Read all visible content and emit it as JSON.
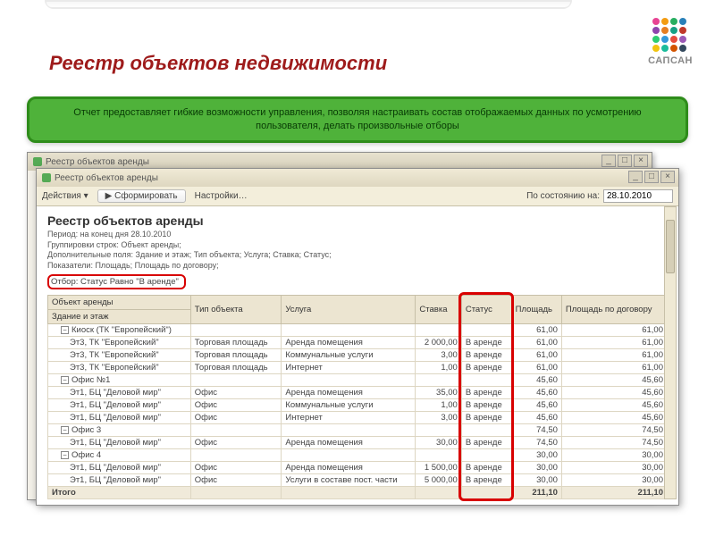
{
  "brand": {
    "name": "САПСАН"
  },
  "slide_title": "Реестр объектов недвижимости",
  "banner_text": "Отчет предоставляет гибкие возможности управления, позволяя настраивать состав отображаемых данных по усмотрению пользователя, делать произвольные отборы",
  "bg_window_title": "Реестр объектов аренды",
  "fg_window": {
    "title": "Реестр объектов аренды",
    "toolbar": {
      "actions_label": "Действия ▾",
      "form_button": "Сформировать",
      "settings_label": "Настройки…",
      "date_label": "По состоянию на:",
      "date_value": "28.10.2010"
    },
    "report": {
      "heading": "Реестр объектов аренды",
      "period": "Период: на конец дня 28.10.2010",
      "grouping": "Группировки строк: Объект аренды;",
      "extra_fields": "Дополнительные поля: Здание и этаж; Тип объекта; Услуга; Ставка; Статус;",
      "indicators": "Показатели: Площадь; Площадь по договору;",
      "filter_label": "Отбор:",
      "filter_value": "Статус Равно \"В аренде\""
    },
    "columns": {
      "c0": "Объект аренды",
      "c0b": "Здание и этаж",
      "c1": "Тип объекта",
      "c2": "Услуга",
      "c3": "Ставка",
      "c4": "Статус",
      "c5": "Площадь",
      "c6": "Площадь по договору"
    },
    "rows": [
      {
        "level": 1,
        "handle": "−",
        "c0": "Киоск (ТК \"Европейский\")",
        "c5": "61,00",
        "c6": "61,00"
      },
      {
        "level": 2,
        "c0": "Эт3, ТК \"Европейский\"",
        "c1": "Торговая площадь",
        "c2": "Аренда помещения",
        "c3": "2 000,00",
        "c4": "В аренде",
        "c5": "61,00",
        "c6": "61,00"
      },
      {
        "level": 2,
        "c0": "Эт3, ТК \"Европейский\"",
        "c1": "Торговая площадь",
        "c2": "Коммунальные услуги",
        "c3": "3,00",
        "c4": "В аренде",
        "c5": "61,00",
        "c6": "61,00"
      },
      {
        "level": 2,
        "c0": "Эт3, ТК \"Европейский\"",
        "c1": "Торговая площадь",
        "c2": "Интернет",
        "c3": "1,00",
        "c4": "В аренде",
        "c5": "61,00",
        "c6": "61,00"
      },
      {
        "level": 1,
        "handle": "−",
        "c0": "Офис №1",
        "c5": "45,60",
        "c6": "45,60"
      },
      {
        "level": 2,
        "c0": "Эт1, БЦ \"Деловой мир\"",
        "c1": "Офис",
        "c2": "Аренда помещения",
        "c3": "35,00",
        "c4": "В аренде",
        "c5": "45,60",
        "c6": "45,60"
      },
      {
        "level": 2,
        "c0": "Эт1, БЦ \"Деловой мир\"",
        "c1": "Офис",
        "c2": "Коммунальные услуги",
        "c3": "1,00",
        "c4": "В аренде",
        "c5": "45,60",
        "c6": "45,60"
      },
      {
        "level": 2,
        "c0": "Эт1, БЦ \"Деловой мир\"",
        "c1": "Офис",
        "c2": "Интернет",
        "c3": "3,00",
        "c4": "В аренде",
        "c5": "45,60",
        "c6": "45,60"
      },
      {
        "level": 1,
        "handle": "−",
        "c0": "Офис 3",
        "c5": "74,50",
        "c6": "74,50"
      },
      {
        "level": 2,
        "c0": "Эт1, БЦ \"Деловой мир\"",
        "c1": "Офис",
        "c2": "Аренда помещения",
        "c3": "30,00",
        "c4": "В аренде",
        "c5": "74,50",
        "c6": "74,50"
      },
      {
        "level": 1,
        "handle": "−",
        "c0": "Офис 4",
        "c5": "30,00",
        "c6": "30,00"
      },
      {
        "level": 2,
        "c0": "Эт1, БЦ \"Деловой мир\"",
        "c1": "Офис",
        "c2": "Аренда помещения",
        "c3": "1 500,00",
        "c4": "В аренде",
        "c5": "30,00",
        "c6": "30,00"
      },
      {
        "level": 2,
        "c0": "Эт1, БЦ \"Деловой мир\"",
        "c1": "Офис",
        "c2": "Услуги в составе пост. части",
        "c3": "5 000,00",
        "c4": "В аренде",
        "c5": "30,00",
        "c6": "30,00"
      },
      {
        "level": 0,
        "c0": "Итого",
        "c5": "211,10",
        "c6": "211,10"
      }
    ]
  },
  "logo_colors": [
    "#e84393",
    "#f39c12",
    "#27ae60",
    "#2980b9",
    "#8e44ad",
    "#e67e22",
    "#16a085",
    "#c0392b",
    "#2ecc71",
    "#3498db",
    "#e74c3c",
    "#9b59b6",
    "#f1c40f",
    "#1abc9c",
    "#d35400",
    "#34495e"
  ]
}
